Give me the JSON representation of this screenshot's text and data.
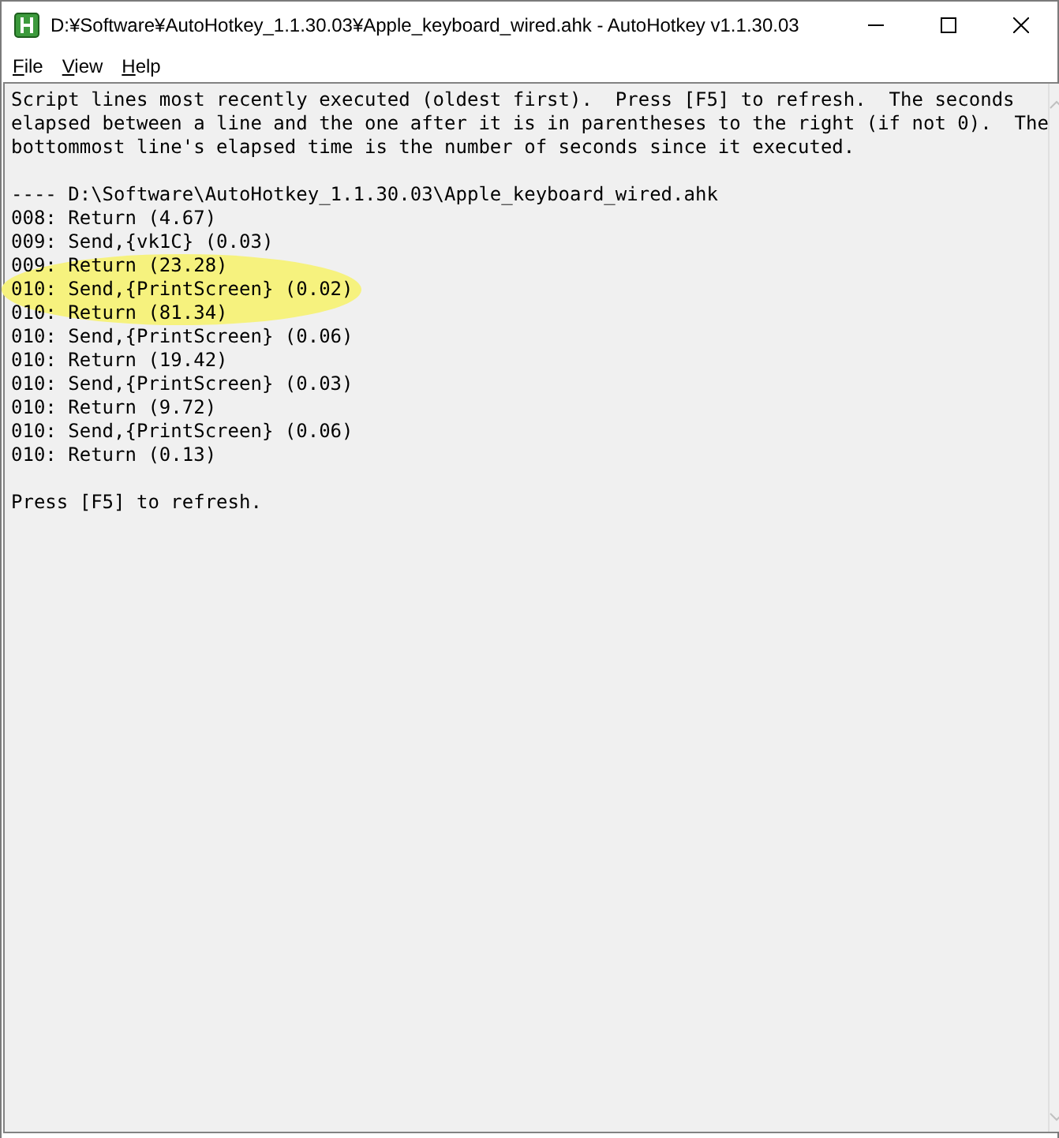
{
  "window": {
    "title": "D:¥Software¥AutoHotkey_1.1.30.03¥Apple_keyboard_wired.ahk - AutoHotkey v1.1.30.03"
  },
  "menu": [
    {
      "label": "File"
    },
    {
      "label": "View"
    },
    {
      "label": "Help"
    }
  ],
  "content": {
    "intro_lines": [
      "Script lines most recently executed (oldest first).  Press [F5] to refresh.  The seconds",
      "elapsed between a line and the one after it is in parentheses to the right (if not 0).  The",
      "bottommost line's elapsed time is the number of seconds since it executed."
    ],
    "header": "---- D:\\Software\\AutoHotkey_1.1.30.03\\Apple_keyboard_wired.ahk",
    "lines": [
      {
        "text": "008: Return (4.67)",
        "highlighted": false
      },
      {
        "text": "009: Send,{vk1C} (0.03)",
        "highlighted": false
      },
      {
        "text": "009: Return (23.28)",
        "highlighted": true
      },
      {
        "text": "010: Send,{PrintScreen} (0.02)",
        "highlighted": true
      },
      {
        "text": "010: Return (81.34)",
        "highlighted": true
      },
      {
        "text": "010: Send,{PrintScreen} (0.06)",
        "highlighted": false
      },
      {
        "text": "010: Return (19.42)",
        "highlighted": false
      },
      {
        "text": "010: Send,{PrintScreen} (0.03)",
        "highlighted": false
      },
      {
        "text": "010: Return (9.72)",
        "highlighted": false
      },
      {
        "text": "010: Send,{PrintScreen} (0.06)",
        "highlighted": false
      },
      {
        "text": "010: Return (0.13)",
        "highlighted": false
      }
    ],
    "footer": "Press [F5] to refresh."
  }
}
